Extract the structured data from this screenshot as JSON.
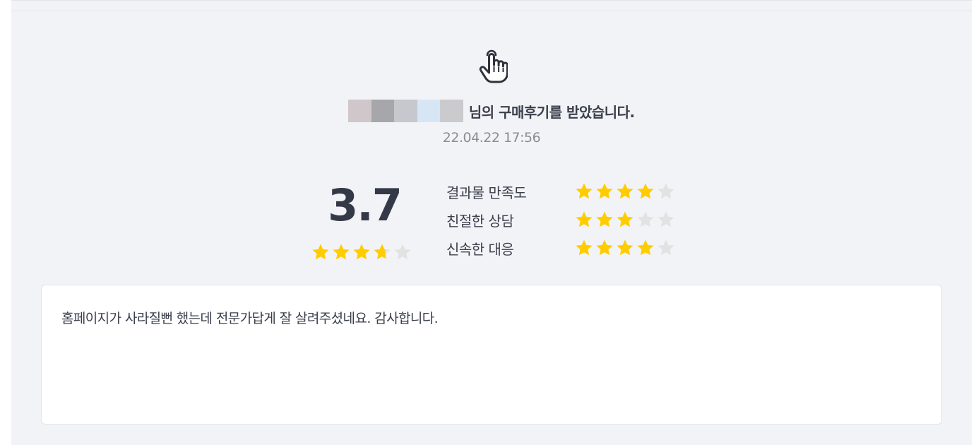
{
  "header": {
    "icon": "pointing-hand-icon",
    "blurred_name_colors": [
      "#cfc7ca",
      "#a6a6ab",
      "#c6c8cd",
      "#d7e6f4",
      "#cbcbce"
    ],
    "message": "님의 구매후기를 받았습니다.",
    "date": "22.04.22 17:56"
  },
  "rating": {
    "overall": "3.7",
    "overall_value": 3.7,
    "max": 5,
    "star_color": "#ffcc00",
    "empty_star_color": "#e2e2e2",
    "criteria": [
      {
        "label": "결과물 만족도",
        "value": 4
      },
      {
        "label": "친절한 상담",
        "value": 3
      },
      {
        "label": "신속한 대응",
        "value": 4
      }
    ]
  },
  "review": {
    "text": "홈페이지가 사라질뻔 했는데 전문가답게 잘 살려주셨네요. 감사합니다."
  }
}
